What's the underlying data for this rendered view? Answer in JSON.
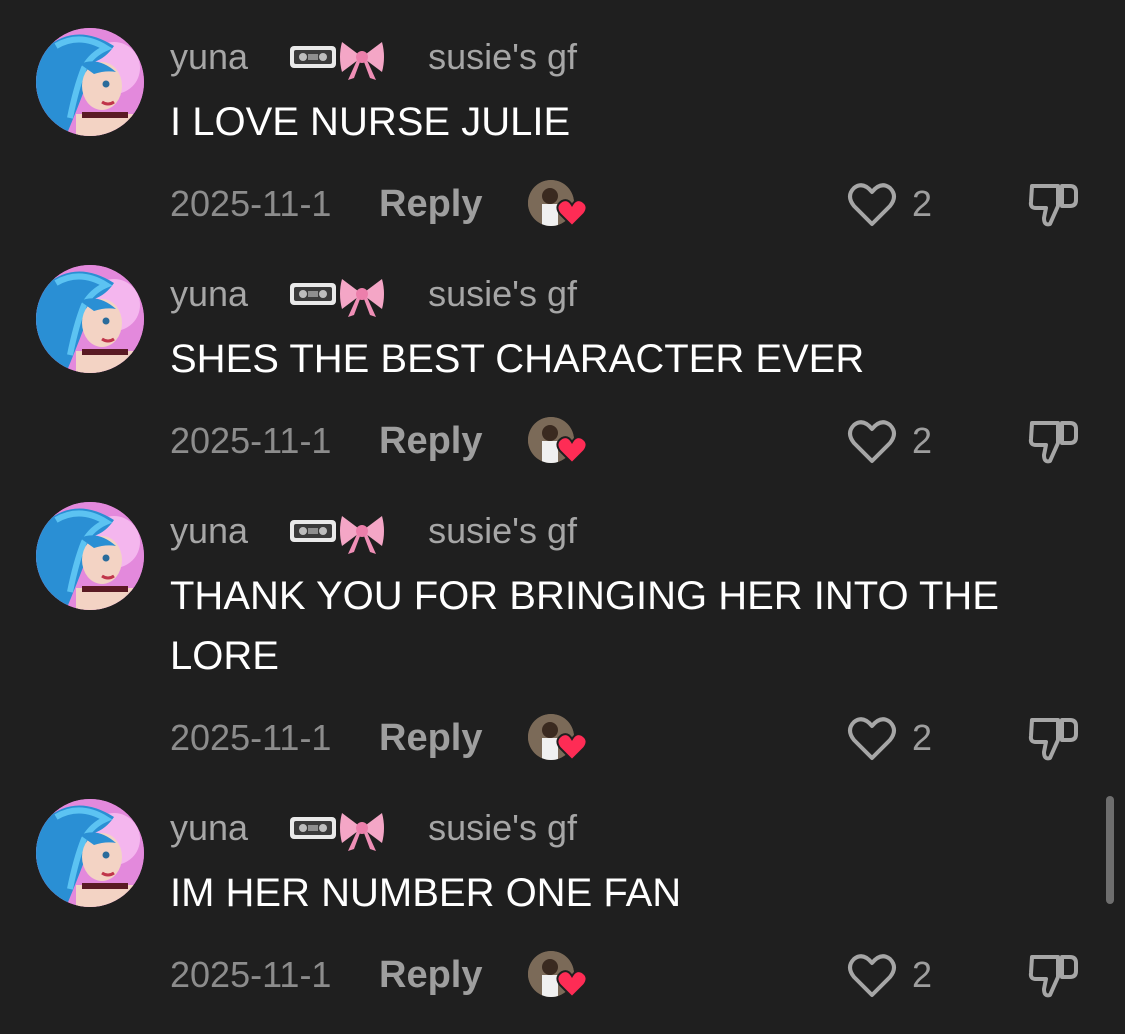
{
  "comments": [
    {
      "username": "yuna",
      "emojis": "📼🎀",
      "badge": "susie's gf",
      "text": "I LOVE NURSE JULIE",
      "date": "2025-11-1",
      "reply_label": "Reply",
      "likes": "2"
    },
    {
      "username": "yuna",
      "emojis": "📼🎀",
      "badge": "susie's gf",
      "text": "SHES THE BEST CHARACTER EVER",
      "date": "2025-11-1",
      "reply_label": "Reply",
      "likes": "2"
    },
    {
      "username": "yuna",
      "emojis": "📼🎀",
      "badge": "susie's gf",
      "text": "THANK YOU FOR BRINGING HER INTO THE LORE",
      "date": "2025-11-1",
      "reply_label": "Reply",
      "likes": "2"
    },
    {
      "username": "yuna",
      "emojis": "📼🎀",
      "badge": "susie's gf",
      "text": "IM HER NUMBER ONE FAN",
      "date": "2025-11-1",
      "reply_label": "Reply",
      "likes": "2"
    }
  ],
  "colors": {
    "background": "#1f1f1f",
    "username": "#a6a6a6",
    "comment_text": "#ffffff",
    "meta_text": "#8c8c8c",
    "creator_heart": "#fe2c55"
  },
  "icons": {
    "avatar": "user-avatar",
    "creator_liked": "creator-liked-heart-icon",
    "like": "heart-outline-icon",
    "dislike": "thumbs-down-icon"
  }
}
